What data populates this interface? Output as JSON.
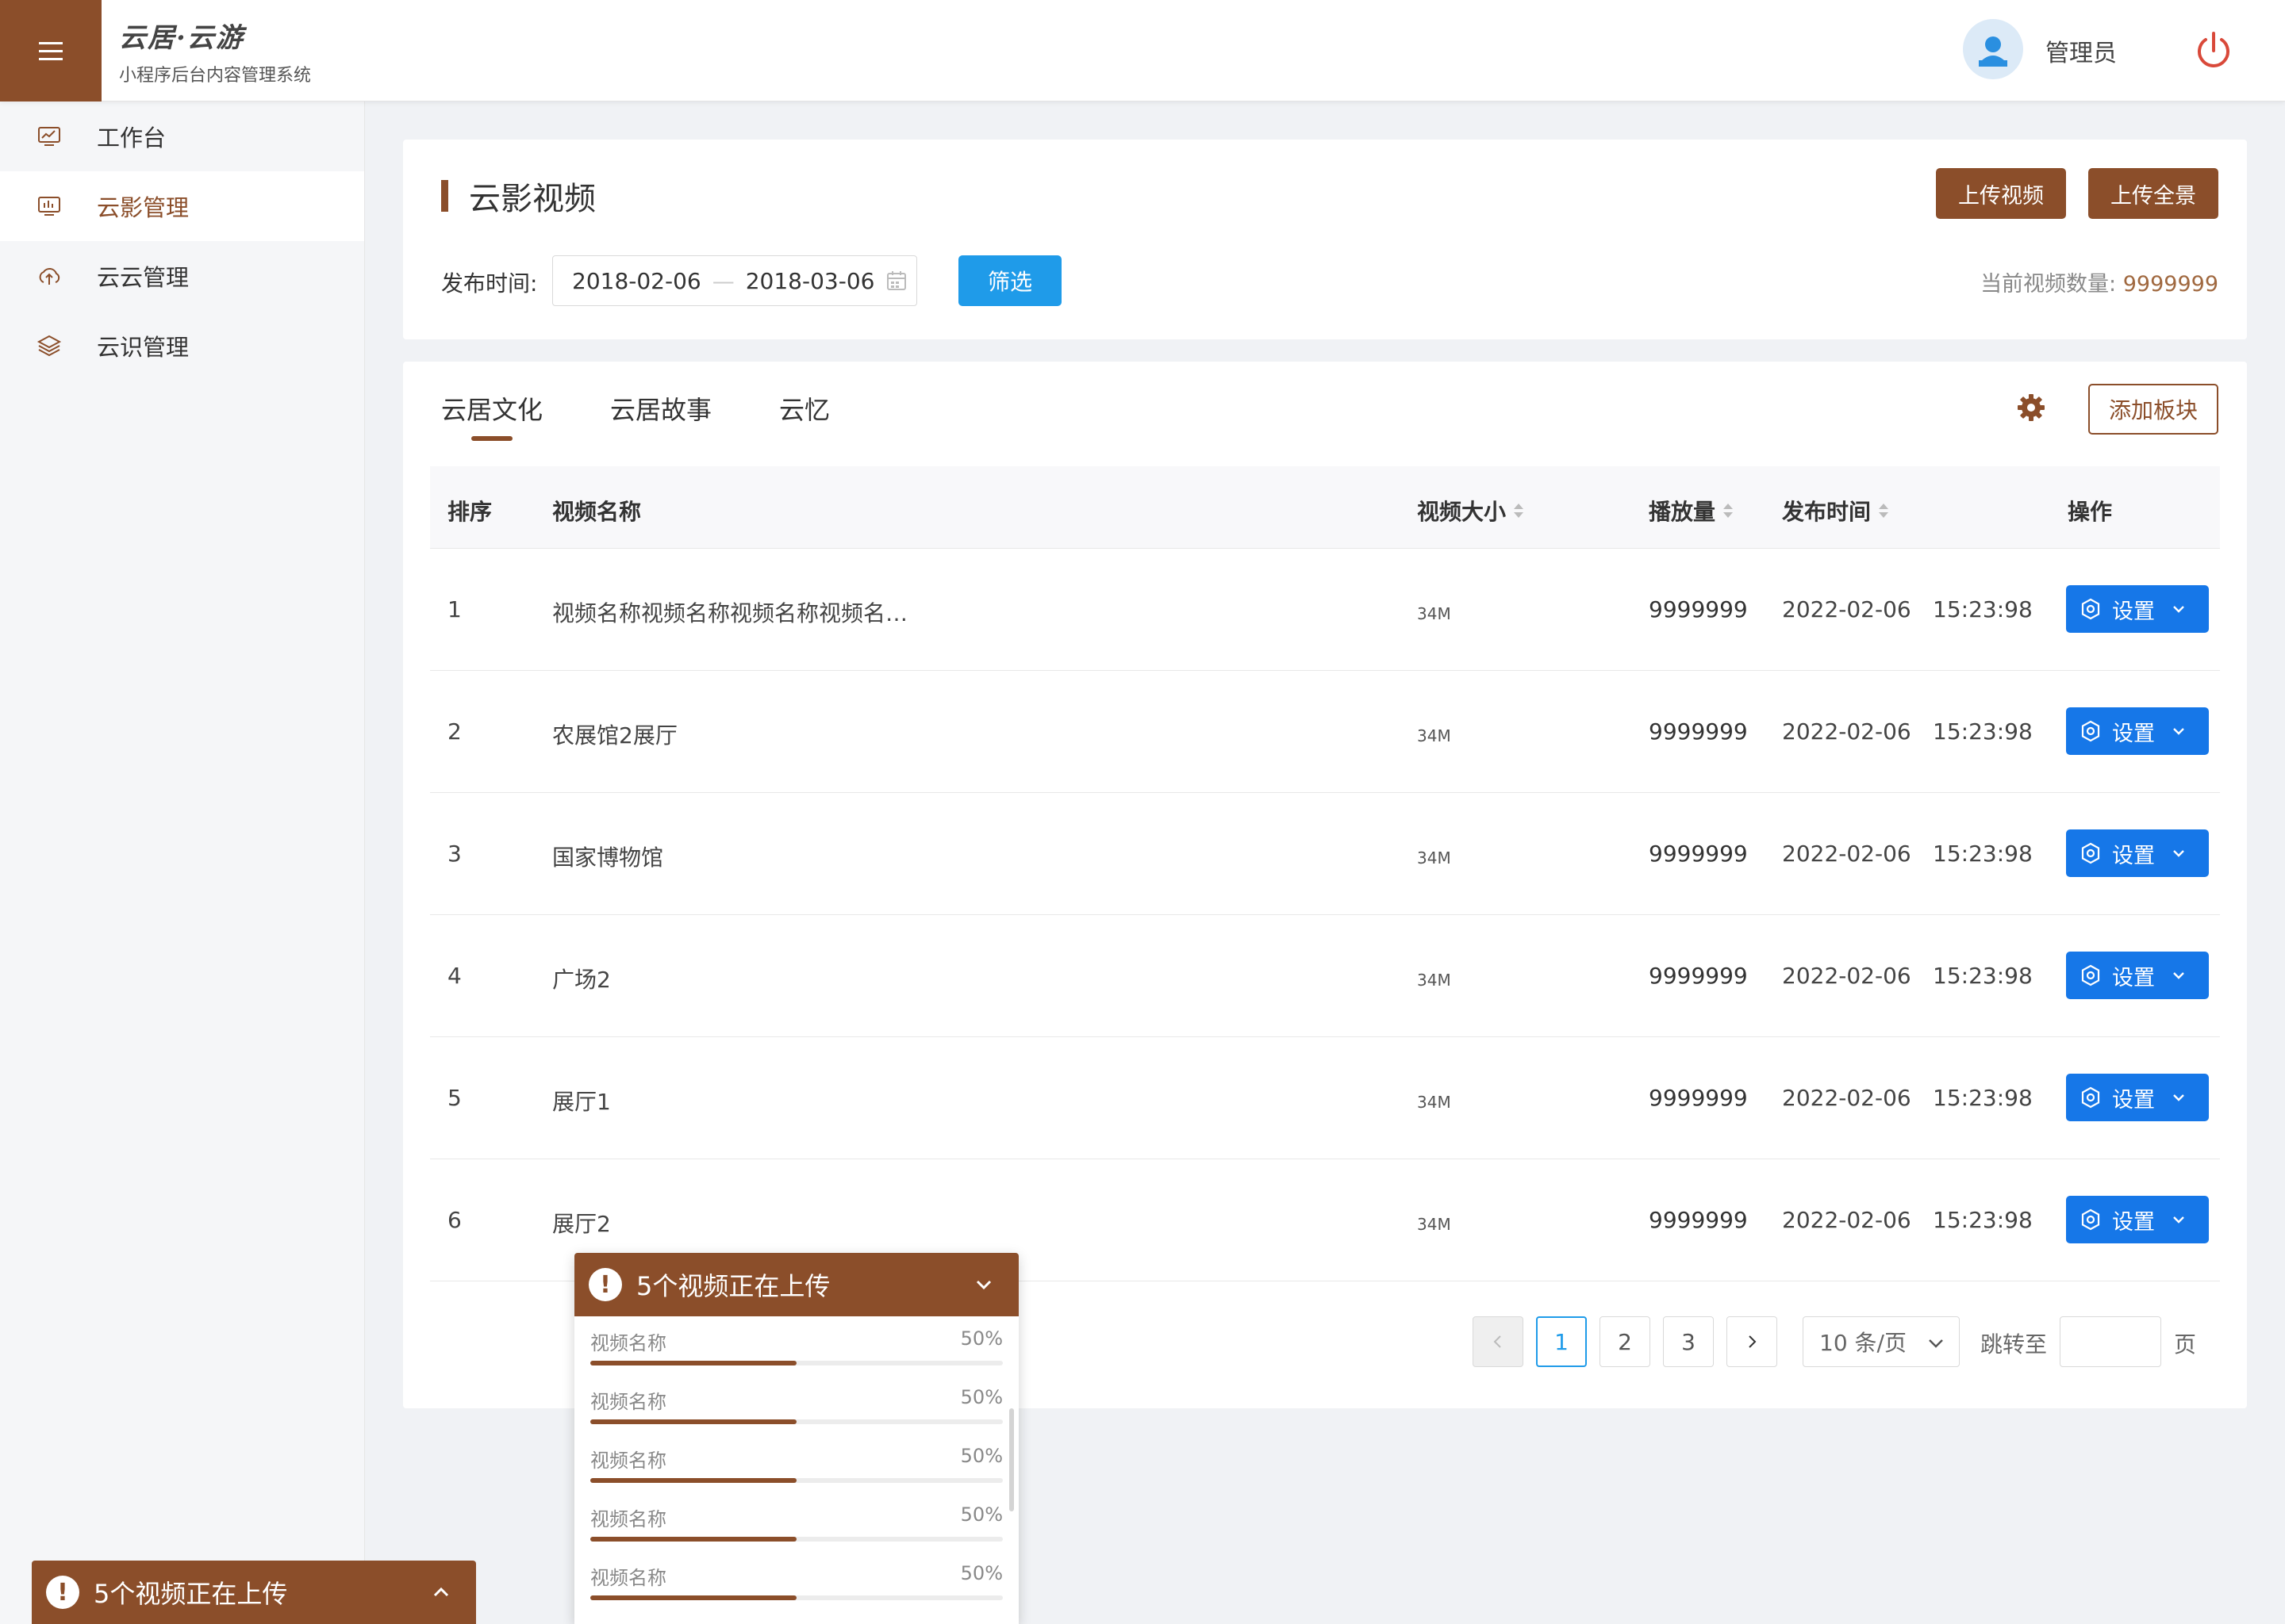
{
  "header": {
    "brand_title": "云居·云游",
    "brand_subtitle": "小程序后台内容管理系统",
    "user_name": "管理员"
  },
  "sidebar": {
    "items": [
      {
        "label": "工作台",
        "icon": "monitor-chart-icon"
      },
      {
        "label": "云影管理",
        "icon": "video-monitor-icon",
        "active": true
      },
      {
        "label": "云云管理",
        "icon": "cloud-upload-icon"
      },
      {
        "label": "云识管理",
        "icon": "layers-icon"
      }
    ]
  },
  "page": {
    "title": "云影视频",
    "upload_video_label": "上传视频",
    "upload_panorama_label": "上传全景",
    "filter_label": "发布时间:",
    "date_start": "2018-02-06",
    "date_separator": "—",
    "date_end": "2018-03-06",
    "filter_button": "筛选",
    "count_label": "当前视频数量: ",
    "count_value": "9999999"
  },
  "tabs": [
    {
      "label": "云居文化",
      "active": true
    },
    {
      "label": "云居故事"
    },
    {
      "label": "云忆"
    }
  ],
  "add_block_label": "添加板块",
  "table": {
    "headers": {
      "order": "排序",
      "name": "视频名称",
      "size": "视频大小",
      "plays": "播放量",
      "published": "发布时间",
      "actions": "操作"
    },
    "rows": [
      {
        "order": "1",
        "name": "视频名称视频名称视频名称视频名…",
        "size": "34M",
        "plays": "9999999",
        "date": "2022-02-06",
        "time": "15:23:98",
        "action": "设置"
      },
      {
        "order": "2",
        "name": "农展馆2展厅",
        "size": "34M",
        "plays": "9999999",
        "date": "2022-02-06",
        "time": "15:23:98",
        "action": "设置"
      },
      {
        "order": "3",
        "name": "国家博物馆",
        "size": "34M",
        "plays": "9999999",
        "date": "2022-02-06",
        "time": "15:23:98",
        "action": "设置"
      },
      {
        "order": "4",
        "name": "广场2",
        "size": "34M",
        "plays": "9999999",
        "date": "2022-02-06",
        "time": "15:23:98",
        "action": "设置"
      },
      {
        "order": "5",
        "name": "展厅1",
        "size": "34M",
        "plays": "9999999",
        "date": "2022-02-06",
        "time": "15:23:98",
        "action": "设置"
      },
      {
        "order": "6",
        "name": "展厅2",
        "size": "34M",
        "plays": "9999999",
        "date": "2022-02-06",
        "time": "15:23:98",
        "action": "设置"
      }
    ]
  },
  "pagination": {
    "pages": [
      "1",
      "2",
      "3"
    ],
    "current": "1",
    "page_size": "10 条/页",
    "jump_label": "跳转至",
    "jump_suffix": "页"
  },
  "upload_panel": {
    "title": "5个视频正在上传",
    "items": [
      {
        "name": "视频名称",
        "percent": "50%",
        "progress": 0.5
      },
      {
        "name": "视频名称",
        "percent": "50%",
        "progress": 0.5
      },
      {
        "name": "视频名称",
        "percent": "50%",
        "progress": 0.5
      },
      {
        "name": "视频名称",
        "percent": "50%",
        "progress": 0.5
      },
      {
        "name": "视频名称",
        "percent": "50%",
        "progress": 0.5
      }
    ]
  },
  "upload_minibar": {
    "title": "5个视频正在上传"
  },
  "colors": {
    "brand": "#8b4e2a",
    "primary_blue": "#1677e8",
    "filter_blue": "#1f9be9"
  }
}
